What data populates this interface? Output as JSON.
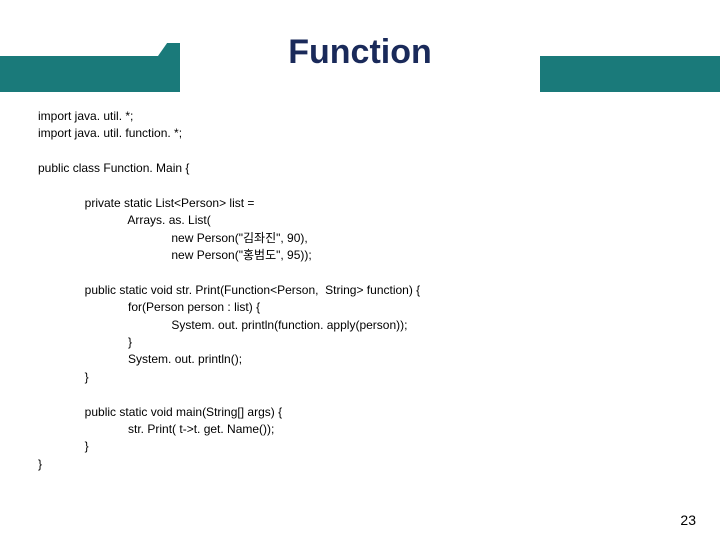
{
  "title": "Function",
  "code": {
    "l1": "import java. util. *;",
    "l2": "import java. util. function. *;",
    "l3": "",
    "l4": "public class Function. Main {",
    "l5": "",
    "l6": "              private static List<Person> list =",
    "l7": "                           Arrays. as. List(",
    "l8": "                                        new Person(\"김좌진\", 90),",
    "l9": "                                        new Person(\"홍범도\", 95));",
    "l10": "",
    "l11": "              public static void str. Print(Function<Person,  String> function) {",
    "l12": "                           for(Person person : list) {",
    "l13": "                                        System. out. println(function. apply(person));",
    "l14": "                           }",
    "l15": "                           System. out. println();",
    "l16": "              }",
    "l17": "",
    "l18": "              public static void main(String[] args) {",
    "l19": "                           str. Print( t->t. get. Name());",
    "l20": "              }",
    "l21": "}"
  },
  "pageNumber": "23"
}
